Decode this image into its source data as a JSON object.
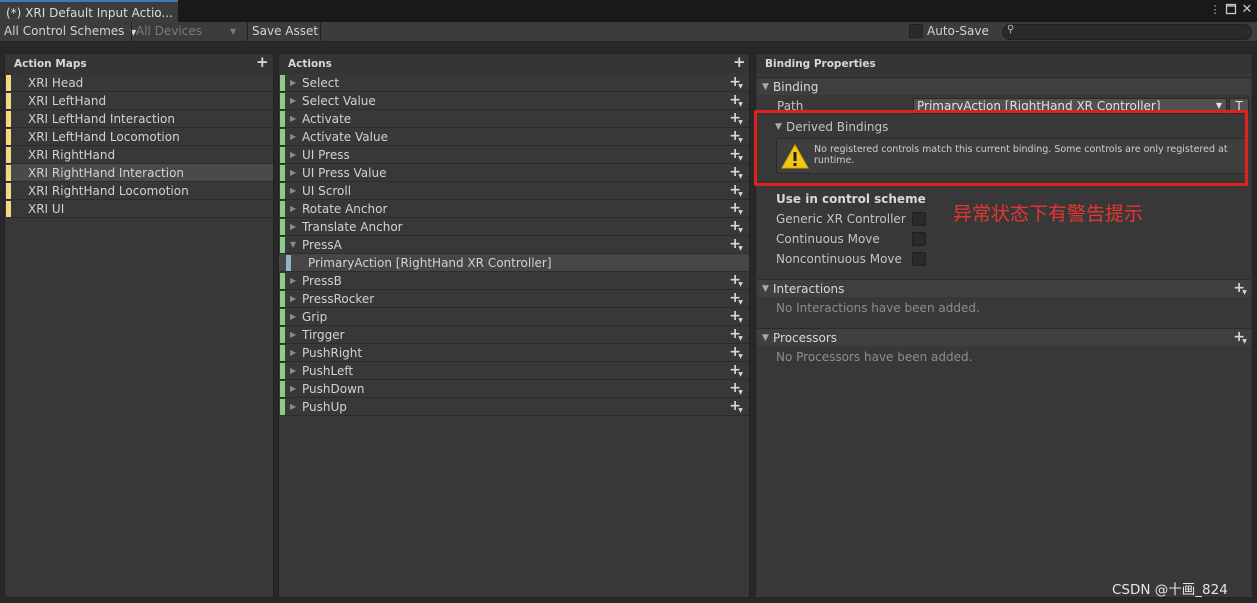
{
  "window": {
    "tab_title": "(*) XRI Default Input Actio...",
    "menu_icon": "kebab-menu-icon",
    "maximize_icon": "maximize-icon",
    "close_icon": "close-icon"
  },
  "toolbar": {
    "control_schemes": "All Control Schemes",
    "devices": "All Devices",
    "save_asset": "Save Asset",
    "auto_save": "Auto-Save",
    "search_placeholder": ""
  },
  "action_maps": {
    "header": "Action Maps",
    "strip_color": "#f5d77f",
    "selected_index": 5,
    "items": [
      "XRI Head",
      "XRI LeftHand",
      "XRI LeftHand Interaction",
      "XRI LeftHand Locomotion",
      "XRI RightHand",
      "XRI RightHand Interaction",
      "XRI RightHand Locomotion",
      "XRI UI"
    ]
  },
  "actions": {
    "header": "Actions",
    "strip_color": "#8fca87",
    "binding_strip_color": "#8fb6c4",
    "items": [
      {
        "label": "Select",
        "expanded": false
      },
      {
        "label": "Select Value",
        "expanded": false
      },
      {
        "label": "Activate",
        "expanded": false
      },
      {
        "label": "Activate Value",
        "expanded": false
      },
      {
        "label": "UI Press",
        "expanded": false
      },
      {
        "label": "UI Press Value",
        "expanded": false
      },
      {
        "label": "UI Scroll",
        "expanded": false
      },
      {
        "label": "Rotate Anchor",
        "expanded": false
      },
      {
        "label": "Translate Anchor",
        "expanded": false
      },
      {
        "label": "PressA",
        "expanded": true,
        "binding": "PrimaryAction [RightHand XR Controller]"
      },
      {
        "label": "PressB",
        "expanded": false
      },
      {
        "label": "PressRocker",
        "expanded": false
      },
      {
        "label": "Grip",
        "expanded": false
      },
      {
        "label": "Tirgger",
        "expanded": false
      },
      {
        "label": "PushRight",
        "expanded": false
      },
      {
        "label": "PushLeft",
        "expanded": false
      },
      {
        "label": "PushDown",
        "expanded": false
      },
      {
        "label": "PushUp",
        "expanded": false
      }
    ]
  },
  "binding_properties": {
    "header": "Binding Properties",
    "binding_section": "Binding",
    "path_label": "Path",
    "path_value": "PrimaryAction [RightHand XR Controller]",
    "t_button": "T",
    "derived_bindings": "Derived Bindings",
    "warning_text": "No registered controls match this current binding. Some controls are only registered at runtime.",
    "use_in_control_scheme": "Use in control scheme",
    "schemes": [
      "Generic XR Controller",
      "Continuous Move",
      "Noncontinuous Move"
    ],
    "interactions_header": "Interactions",
    "interactions_empty": "No Interactions have been added.",
    "processors_header": "Processors",
    "processors_empty": "No Processors have been added."
  },
  "annotation": {
    "text": "异常状态下有警告提示",
    "color": "#e8352f"
  },
  "watermark": "CSDN @十画_824"
}
